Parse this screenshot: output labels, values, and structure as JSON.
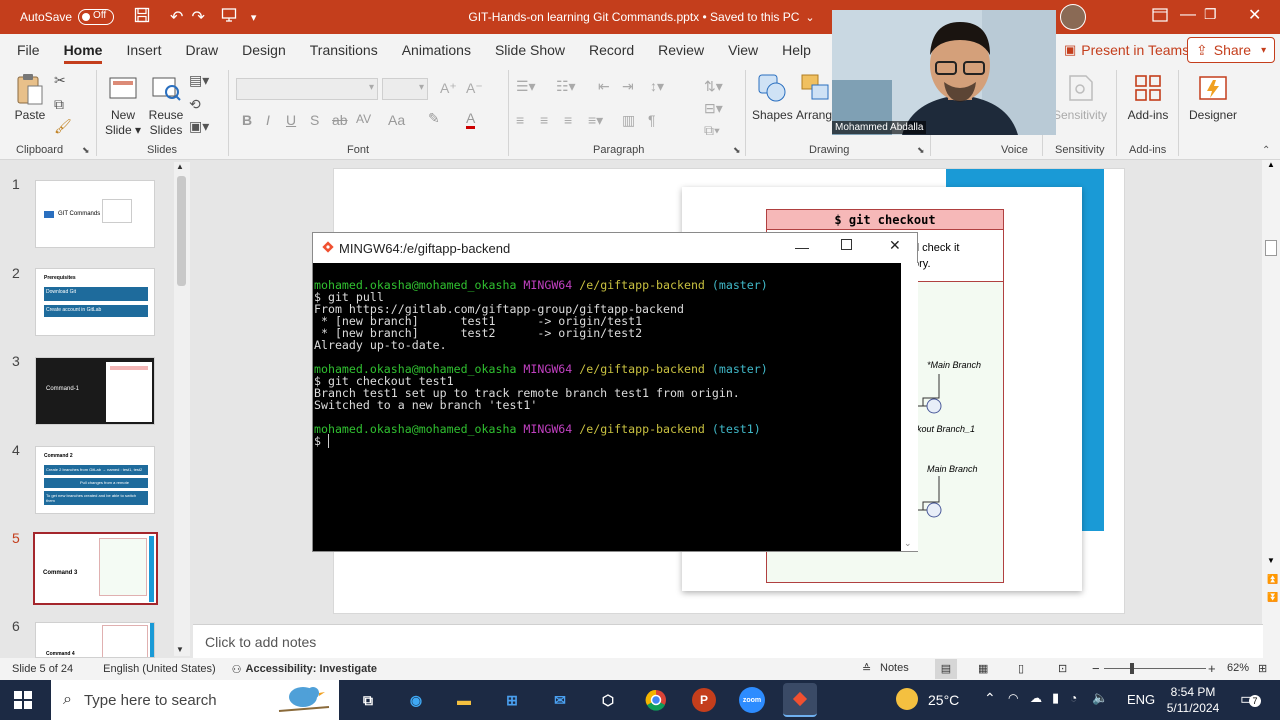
{
  "titlebar": {
    "autosave_label": "AutoSave",
    "autosave_state": "Off",
    "document_title": "GIT-Hands-on learning Git Commands.pptx • Saved to this PC",
    "title_chevron": "chevron-down-icon"
  },
  "menu": {
    "items": [
      "File",
      "Home",
      "Insert",
      "Draw",
      "Design",
      "Transitions",
      "Animations",
      "Slide Show",
      "Record",
      "Review",
      "View",
      "Help"
    ],
    "active": "Home",
    "present_in_teams": "Present in Teams",
    "share": "Share"
  },
  "ribbon": {
    "clipboard": {
      "paste": "Paste",
      "group": "Clipboard"
    },
    "slides": {
      "new_slide_1": "New",
      "new_slide_2": "Slide",
      "reuse_1": "Reuse",
      "reuse_2": "Slides",
      "group": "Slides"
    },
    "font": {
      "group": "Font",
      "bold": "B",
      "italic": "I",
      "underline": "U",
      "strike": "S",
      "spacing": "AV",
      "case": "Aa"
    },
    "paragraph": {
      "group": "Paragraph"
    },
    "drawing": {
      "shapes": "Shapes",
      "arrange": "Arrang",
      "group": "Drawing"
    },
    "voice": {
      "group": "Voice"
    },
    "sensitivity": {
      "label": "Sensitivity",
      "group": "Sensitivity"
    },
    "addins": {
      "label": "Add-ins",
      "group": "Add-ins"
    },
    "designer": {
      "label": "Designer"
    }
  },
  "webcam": {
    "name": "Mohammed Abdalla"
  },
  "thumbnails": [
    {
      "num": "1",
      "title": "GIT Commands",
      "subtitle": ""
    },
    {
      "num": "2",
      "title": "Prerequisites",
      "lines": [
        "Download Git",
        "Create account in GitLab"
      ]
    },
    {
      "num": "3",
      "title": "Command-1"
    },
    {
      "num": "4",
      "title": "Command 2",
      "lines": [
        "Create 2 branches from GitLab → named : test1, test2",
        "Pull changes from a remote",
        "To get new branches created and be able to switch them"
      ]
    },
    {
      "num": "5",
      "title": "Command 3",
      "active": true
    },
    {
      "num": "6",
      "title": "Command 4"
    }
  ],
  "slide": {
    "card_title": "$ git checkout",
    "card_text_1": "d check it",
    "card_text_2": "ory.",
    "label_main_branch_1": "*Main Branch",
    "label_checkout": "kout Branch_1",
    "label_main_branch_2": "Main Branch"
  },
  "terminal": {
    "title": "MINGW64:/e/giftapp-backend",
    "user": "mohamed.okasha@mohamed_okasha",
    "env": "MINGW64",
    "path": "/e/giftapp-backend",
    "branch_1": "(master)",
    "cmd_1": "$ git pull",
    "out_1": "From https://gitlab.com/giftapp-group/giftapp-backend",
    "out_2": " * [new branch]      test1      -> origin/test1",
    "out_3": " * [new branch]      test2      -> origin/test2",
    "out_4": "Already up-to-date.",
    "branch_2": "(master)",
    "cmd_2": "$ git checkout test1",
    "out_5": "Branch test1 set up to track remote branch test1 from origin.",
    "out_6": "Switched to a new branch 'test1'",
    "branch_3": "(test1)",
    "prompt": "$ "
  },
  "notes": {
    "placeholder": "Click to add notes"
  },
  "status": {
    "slide_info": "Slide 5 of 24",
    "language": "English (United States)",
    "accessibility": "Accessibility: Investigate",
    "notes": "Notes",
    "zoom": "62%"
  },
  "taskbar": {
    "search_placeholder": "Type here to search",
    "temperature": "25°C",
    "lang": "ENG",
    "time": "8:54 PM",
    "date": "5/11/2024",
    "notif_count": "7"
  },
  "colors": {
    "accent": "#c43e1c",
    "taskbar": "#1c2a44",
    "terminal_bg": "#000000"
  }
}
